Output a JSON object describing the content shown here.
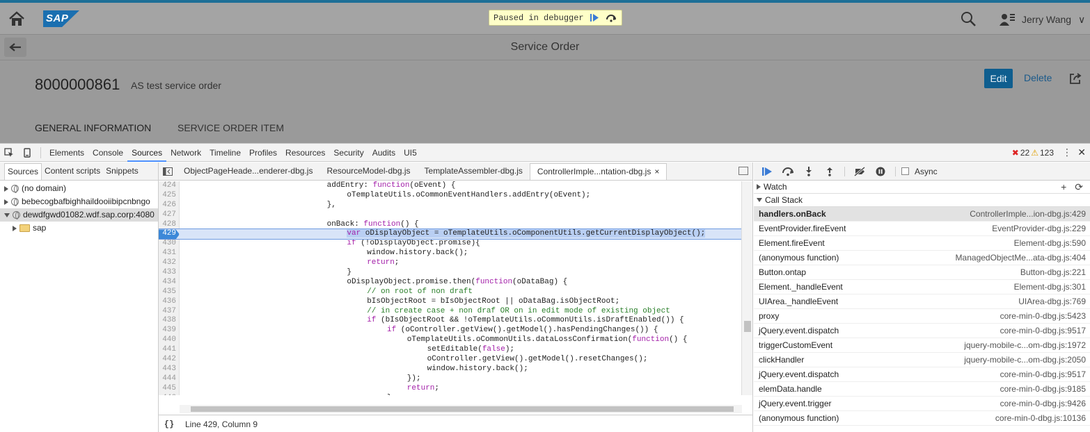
{
  "app": {
    "paused_label": "Paused in debugger",
    "user_name": "Jerry Wang",
    "logo_text": "SAP",
    "page_title": "Service Order",
    "object_id": "8000000861",
    "object_description": "AS test service order",
    "edit_label": "Edit",
    "delete_label": "Delete",
    "sections": [
      "GENERAL INFORMATION",
      "SERVICE ORDER ITEM"
    ]
  },
  "devtools": {
    "tabs": [
      "Elements",
      "Console",
      "Sources",
      "Network",
      "Timeline",
      "Profiles",
      "Resources",
      "Security",
      "Audits",
      "UI5"
    ],
    "active_tab": "Sources",
    "error_count": "22",
    "warning_count": "123",
    "navigator_tabs": [
      "Sources",
      "Content scripts",
      "Snippets"
    ],
    "tree": [
      {
        "label": "(no domain)",
        "icon": "globe-icon",
        "expanded": false,
        "indent": 0
      },
      {
        "label": "bebecogbafbighhaildooiibipcnbngo",
        "icon": "globe-icon",
        "expanded": false,
        "indent": 0
      },
      {
        "label": "dewdfgwd01082.wdf.sap.corp:4080",
        "icon": "globe-icon",
        "expanded": true,
        "indent": 0,
        "selected": true
      },
      {
        "label": "sap",
        "icon": "folder-icon",
        "expanded": false,
        "indent": 1
      }
    ],
    "editor_tabs": [
      {
        "label": "ObjectPageHeade...enderer-dbg.js",
        "active": false
      },
      {
        "label": "ResourceModel-dbg.js",
        "active": false
      },
      {
        "label": "TemplateAssembler-dbg.js",
        "active": false
      },
      {
        "label": "ControllerImple...ntation-dbg.js",
        "active": true
      }
    ],
    "code_lines": [
      {
        "n": "424",
        "indent": 28,
        "segs": [
          [
            "p",
            "addEntry: "
          ],
          [
            "kw",
            "function"
          ],
          [
            "p",
            "(oEvent) {"
          ]
        ]
      },
      {
        "n": "425",
        "indent": 32,
        "segs": [
          [
            "p",
            "oTemplateUtils.oCommonEventHandlers.addEntry(oEvent);"
          ]
        ]
      },
      {
        "n": "426",
        "indent": 28,
        "segs": [
          [
            "p",
            "},"
          ]
        ]
      },
      {
        "n": "427",
        "indent": 0,
        "segs": []
      },
      {
        "n": "428",
        "indent": 28,
        "segs": [
          [
            "p",
            "onBack: "
          ],
          [
            "kw",
            "function"
          ],
          [
            "p",
            "() {"
          ]
        ]
      },
      {
        "n": "429",
        "indent": 32,
        "bp": true,
        "cur": true,
        "segs": [
          [
            "kw",
            "var"
          ],
          [
            "p",
            " oDisplayObject = oTemplateUtils.oComponentUtils.getCurrentDisplayObject();"
          ]
        ]
      },
      {
        "n": "430",
        "indent": 32,
        "segs": [
          [
            "kw",
            "if"
          ],
          [
            "p",
            " (!oDisplayObject.promise){"
          ]
        ]
      },
      {
        "n": "431",
        "indent": 36,
        "segs": [
          [
            "p",
            "window.history.back();"
          ]
        ]
      },
      {
        "n": "432",
        "indent": 36,
        "segs": [
          [
            "kw",
            "return"
          ],
          [
            "p",
            ";"
          ]
        ]
      },
      {
        "n": "433",
        "indent": 32,
        "segs": [
          [
            "p",
            "}"
          ]
        ]
      },
      {
        "n": "434",
        "indent": 32,
        "segs": [
          [
            "p",
            "oDisplayObject.promise.then("
          ],
          [
            "kw",
            "function"
          ],
          [
            "p",
            "(oDataBag) {"
          ]
        ]
      },
      {
        "n": "435",
        "indent": 36,
        "segs": [
          [
            "cm",
            "// on root of non draft"
          ]
        ]
      },
      {
        "n": "436",
        "indent": 36,
        "segs": [
          [
            "p",
            "bIsObjectRoot = bIsObjectRoot || oDataBag.isObjectRoot;"
          ]
        ]
      },
      {
        "n": "437",
        "indent": 36,
        "segs": [
          [
            "cm",
            "// in create case + non draf OR on in edit mode of existing object"
          ]
        ]
      },
      {
        "n": "438",
        "indent": 36,
        "segs": [
          [
            "kw",
            "if"
          ],
          [
            "p",
            " (bIsObjectRoot && !oTemplateUtils.oCommonUtils.isDraftEnabled()) {"
          ]
        ]
      },
      {
        "n": "439",
        "indent": 40,
        "segs": [
          [
            "kw",
            "if"
          ],
          [
            "p",
            " (oController.getView().getModel().hasPendingChanges()) {"
          ]
        ]
      },
      {
        "n": "440",
        "indent": 44,
        "segs": [
          [
            "p",
            "oTemplateUtils.oCommonUtils.dataLossConfirmation("
          ],
          [
            "kw",
            "function"
          ],
          [
            "p",
            "() {"
          ]
        ]
      },
      {
        "n": "441",
        "indent": 48,
        "segs": [
          [
            "p",
            "setEditable("
          ],
          [
            "kw",
            "false"
          ],
          [
            "p",
            ");"
          ]
        ]
      },
      {
        "n": "442",
        "indent": 48,
        "segs": [
          [
            "p",
            "oController.getView().getModel().resetChanges();"
          ]
        ]
      },
      {
        "n": "443",
        "indent": 48,
        "segs": [
          [
            "p",
            "window.history.back();"
          ]
        ]
      },
      {
        "n": "444",
        "indent": 44,
        "segs": [
          [
            "p",
            "});"
          ]
        ]
      },
      {
        "n": "445",
        "indent": 44,
        "segs": [
          [
            "kw",
            "return"
          ],
          [
            "p",
            ";"
          ]
        ]
      },
      {
        "n": "446",
        "indent": 40,
        "segs": [
          [
            "p",
            "}"
          ]
        ]
      },
      {
        "n": "447",
        "indent": 36,
        "segs": []
      }
    ],
    "status_pretty": "{}",
    "status_position": "Line 429, Column 9",
    "async_label": "Async",
    "watch_label": "Watch",
    "call_stack_label": "Call Stack",
    "call_stack": [
      {
        "fn": "handlers.onBack",
        "loc": "ControllerImple...ion-dbg.js:429",
        "selected": true
      },
      {
        "fn": "EventProvider.fireEvent",
        "loc": "EventProvider-dbg.js:229"
      },
      {
        "fn": "Element.fireEvent",
        "loc": "Element-dbg.js:590"
      },
      {
        "fn": "(anonymous function)",
        "loc": "ManagedObjectMe...ata-dbg.js:404"
      },
      {
        "fn": "Button.ontap",
        "loc": "Button-dbg.js:221"
      },
      {
        "fn": "Element._handleEvent",
        "loc": "Element-dbg.js:301"
      },
      {
        "fn": "UIArea._handleEvent",
        "loc": "UIArea-dbg.js:769"
      },
      {
        "fn": "proxy",
        "loc": "core-min-0-dbg.js:5423"
      },
      {
        "fn": "jQuery.event.dispatch",
        "loc": "core-min-0-dbg.js:9517"
      },
      {
        "fn": "triggerCustomEvent",
        "loc": "jquery-mobile-c...om-dbg.js:1972"
      },
      {
        "fn": "clickHandler",
        "loc": "jquery-mobile-c...om-dbg.js:2050"
      },
      {
        "fn": "jQuery.event.dispatch",
        "loc": "core-min-0-dbg.js:9517"
      },
      {
        "fn": "elemData.handle",
        "loc": "core-min-0-dbg.js:9185"
      },
      {
        "fn": "jQuery.event.trigger",
        "loc": "core-min-0-dbg.js:9426"
      },
      {
        "fn": "(anonymous function)",
        "loc": "core-min-0-dbg.js:10136"
      }
    ]
  }
}
